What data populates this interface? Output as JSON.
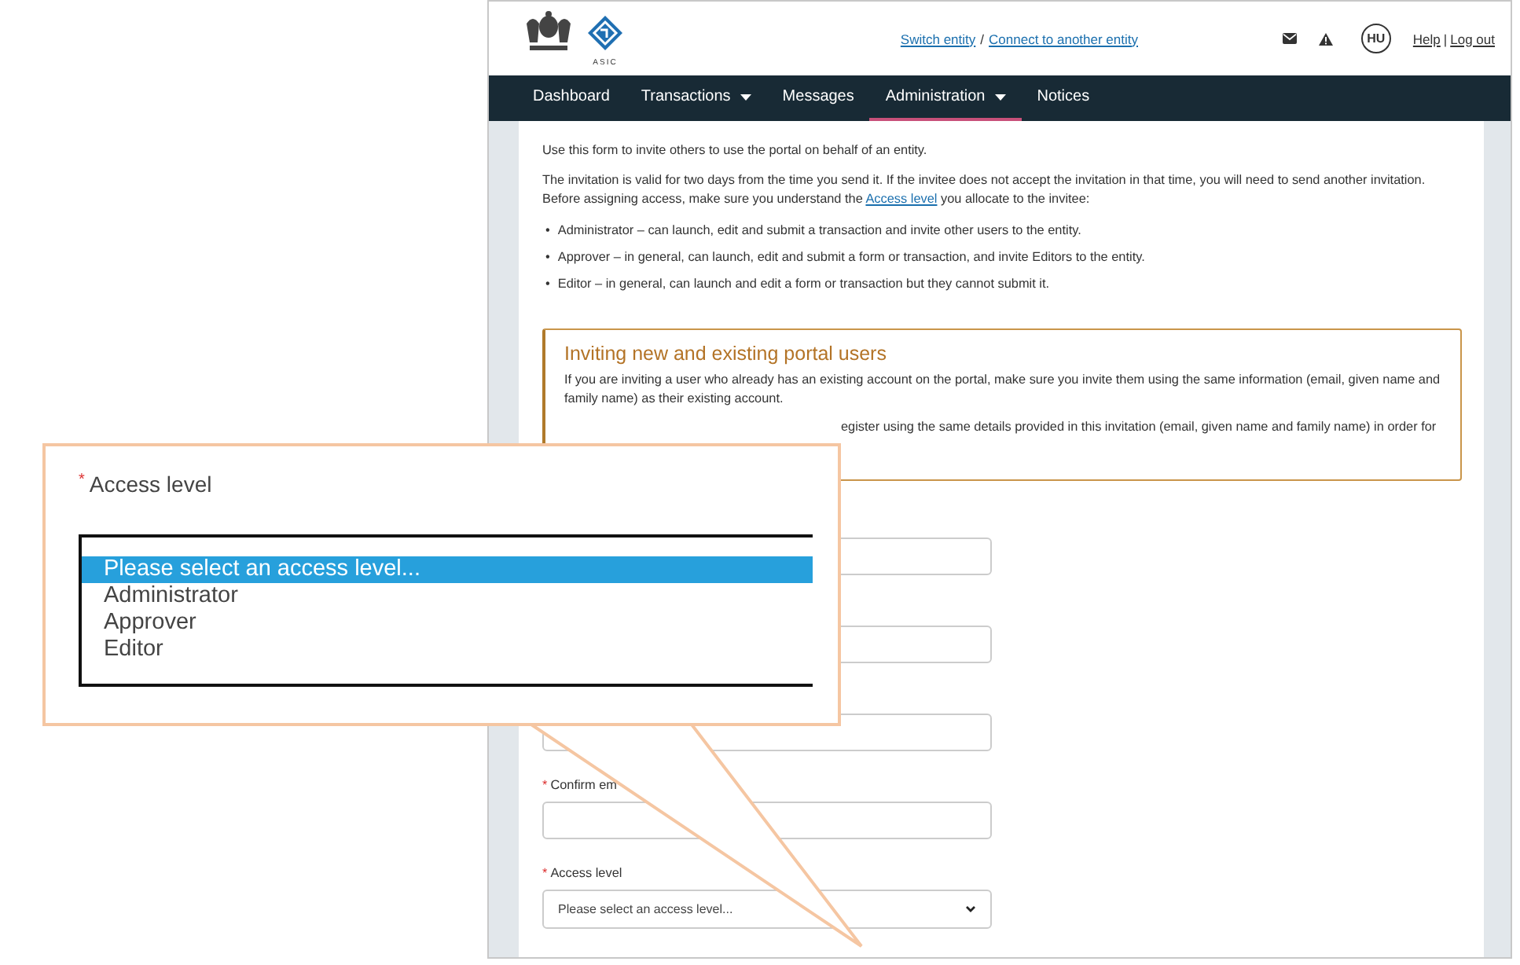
{
  "header": {
    "logo_text": "ASIC",
    "links": [
      {
        "label": "Switch entity"
      },
      {
        "label": "Connect to another entity"
      }
    ],
    "link_separator": "/",
    "avatar": "HU",
    "user_links": [
      {
        "label": "Help"
      },
      {
        "label": "Log out"
      }
    ],
    "user_separator": "|"
  },
  "nav": [
    {
      "label": "Dashboard",
      "dropdown": false,
      "selected": false
    },
    {
      "label": "Transactions",
      "dropdown": true,
      "selected": false
    },
    {
      "label": "Messages",
      "dropdown": false,
      "selected": false
    },
    {
      "label": "Administration",
      "dropdown": true,
      "selected": true
    },
    {
      "label": "Notices",
      "dropdown": false,
      "selected": false
    }
  ],
  "intro": [
    {
      "text": "Use this form to invite others to use the portal on behalf of an entity."
    },
    {
      "text": "The invitation is valid for two days from the time you send it. If the invitee does not accept the invitation in that time, you will need to send another invitation.",
      "link_before": "Before assigning access, make sure you understand the",
      "link": "Access level",
      "link_after": "you allocate to the invitee:"
    }
  ],
  "bullet": "•",
  "access_levels": [
    "Administrator – can launch, edit and submit a transaction and invite other users to the entity.",
    "Approver – in general, can launch, edit and submit a form or transaction, and invite Editors to the entity.",
    "Editor – in general, can launch and edit a form or transaction but they cannot submit it."
  ],
  "notice": {
    "title": "Inviting new and existing portal users",
    "paragraphs": [
      "If you are inviting a user who already has an existing account on the portal, make sure you invite them using the same information (email, given name and family name) as their existing account.",
      "egister using the same details provided in this invitation (email, given name and family name) in order for"
    ]
  },
  "required_mark": "*",
  "form": [
    {
      "kind": "input"
    },
    {
      "kind": "input"
    },
    {
      "kind": "input"
    },
    {
      "kind": "input",
      "label": "Confirm em",
      "required": true
    },
    {
      "kind": "select",
      "label": "Access level",
      "required": true,
      "value": "Please select an access level..."
    }
  ],
  "callout": {
    "label": "Access level",
    "required": true,
    "options": [
      {
        "label": "Please select an access level...",
        "selected": true
      },
      {
        "label": "Administrator",
        "selected": false
      },
      {
        "label": "Approver",
        "selected": false
      },
      {
        "label": "Editor",
        "selected": false
      }
    ]
  }
}
